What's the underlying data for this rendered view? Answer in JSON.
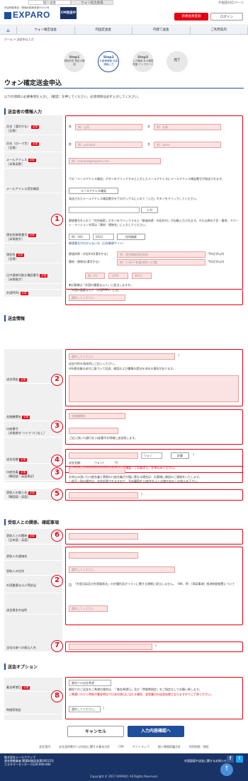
{
  "topbar": {
    "tabs": [
      "個人送金",
      "ウォン紀念金操"
    ],
    "lang": "外国語対応ページ"
  },
  "header": {
    "logo_sub": "資金移動業者・関東財務局長第00015号",
    "logo": "EXPARO",
    "cm": "CM放送中",
    "register": "新規会員登録",
    "login": "ログイン"
  },
  "nav": {
    "home": "⌂",
    "items": [
      "ウォン確定送金",
      "円固定送金",
      "円建て送金",
      "ご利用案内"
    ]
  },
  "breadcrumb": "ホーム > 送金申込入力",
  "steps": [
    {
      "t": "Step1",
      "s": "規約的意 規定の確認"
    },
    {
      "t": "Step2",
      "s": "お客様情報 送金情報入力"
    },
    {
      "t": "Step3",
      "s": "入力確認 本人確認書類 アップロード"
    },
    {
      "t": "完了",
      "s": ""
    }
  ],
  "page_title": "ウォン確定送金申込",
  "note": "以下の項目に必要事項を入力し［確認］を押してください。必須項目は必ず入力してください。",
  "req": "必須",
  "sec1": "送金者の情報入力",
  "kanji_label": "氏名（漢字かな）",
  "kanji_sub": "［全角］",
  "kanji_sei": "姓",
  "kanji_mei": "名",
  "kanji_ph1": "例）山田",
  "kanji_ph2": "例）太郎",
  "roman_label": "氏名（ローマ字）",
  "roman_sub": "［全角］",
  "roman_ph1": "例）yamada",
  "roman_ph2": "例）tarou",
  "email_label": "メールアドレス",
  "email_sub": "［半角英数］",
  "email_ph": "例）example@exparo.com",
  "email_conf_label": "メールアドレス受信確認",
  "email_conf_txt1": "下の「メールアドレス確認」ボタンをクリックすると入力したメールアドレスにメールアドレス確認番号が発送されます。",
  "email_conf_btn": "メールアドレス確認",
  "email_conf_txt2": "発送されたメールアドレス確認番号を下のボックスに入れて「入力」ボタンをクリックしてください。",
  "email_conf_enter": "入力",
  "zip_label": "現住所郵便番号",
  "zip_sub": "［半角数字］",
  "zip_txt": "郵便番号を入れて「住所検索」ボタンをクリックすると「都道府県・市区町村」が自動入力されます。それ以降の丁目・番地、アパート・マンション名等は「番地・建物名」に入力してください。",
  "zip1": "例）160",
  "zip2": "0022",
  "zip_btn": "住所検索",
  "zip_unknown": "郵便番号がわからない方（日本郵便サイト）",
  "addr_label": "現住所",
  "addr_sub": "［全角］",
  "addr_city_lbl": "都道府県・市区町村(漢字かな)",
  "addr_city_ph": "例）東京都新宿区新宿",
  "addr_street_lbl": "番地・建物名(漢字かな)",
  "addr_street_ph": "例）1-36-7 新宿内野ビル2階",
  "addr_limit": "*50文字以内",
  "phone_label": "日中連絡可能な電話番号",
  "phone_sub": "［半角数字］",
  "phone": [
    "例）03",
    "3359",
    "0023"
  ],
  "peps_label": "外国PEPs",
  "peps_txt1": "▼お客様は「外国の重要な公人」に該当しますか。",
  "peps_txt2": "『外国の重要な公人（外国PEPs）とは』",
  "select_ph": "選択してください",
  "sec2": "送金情報",
  "purpose_label": "送金理由",
  "purpose_txt1": "送金目的を具体的にご記入ください。",
  "purpose_txt2": "※所属金額の送付に基づいて記述。確認および書類の提出を求める場合があります。",
  "bank_label": "金融機関名",
  "bank_sel": "金融機関名",
  "acct_label": "口座番号",
  "acct_sub": "［半角数字 ハイフン(-)なし］",
  "acct_txt": "ご記入頂いた銀行名 口座番号を明確に送金致します。",
  "amount_label": "送金金額",
  "amount_cur": "ウォン",
  "amount_calc": "計算",
  "amount_row2a": "送金金額：",
  "amount_row2b": "ウォン/",
  "amount_row2c": "円",
  "amount_warn": "※ 送金サービスの内容にご留意ください。ご確認・ご同意の上、お申込みください。",
  "acct_name_label": "口座名義",
  "acct_name_sub": "［韓国語・英語表記］",
  "acct_name_txt1": "お申込み頂いた口座名義と実際の口座名義が大幅に異なる場合は、お客様に確認のご連絡をいたします。",
  "acct_name_txt2": "一部不一致の場合は、送金処理されますので、予め韓国名 口座名をよくお確かめの上お申込み下さい。",
  "recv_name_label": "受取人の個人名",
  "recv_name_sub": "［韓国語・英語］",
  "sec3": "受取人との関係、確認事項",
  "rel_label": "受取人との関係",
  "rel_sub": "［日本語・英語］",
  "recv_phone_label": "受取人の連絡先",
  "recv_addr_label": "受取人の住所",
  "recv_peps_label": "外国重要な公人等該当",
  "recv_peps_txt": "「外国当局及び外国貿易法」の在籍所及びイランに関する規制に該当しません。（NK、IR）［承認事項］経済制裁措置について",
  "recv_type_label": "送金資金の出所",
  "recv_person_label": "当社口座への振込人名",
  "sec4": "送金オプション",
  "opt_date_label": "着金希望日",
  "opt_date_sel": "最短での送金希望",
  "opt_date_txt1": "最短でのご送金をご希望の場合は、「着金希望日」及び「時間帯指定」をご指定なしでお願い致します。",
  "opt_date_txt2": "ご希望いただく時刻が着金時点で日本の休日に当たる場合、翌営業日の送金処理となりますのでご了承ください。",
  "opt_time_label": "時間帯指定",
  "opt_time_sel": "選択してください。",
  "cancel": "キャンセル",
  "confirm": "入力内容確認へ",
  "footer_links": [
    "会社案内",
    "反社会的勢力への対応に関する基本方針",
    "CPA",
    "サイトマップ",
    "個人情報保護方針",
    "利用約款・規定"
  ],
  "footer_co": [
    "株式会社シーエクアップ",
    "資金移動業者 関東財務局長第00015号",
    "カスタマーセンター 0120-000-000"
  ],
  "footer_follow": "外国語版や送金に関するお知らせ",
  "copyright": "Copyright © 2017 EXPARO. All Rights Reserved.",
  "markers": [
    "1",
    "2",
    "3",
    "4",
    "3",
    "5",
    "6",
    "2",
    "7",
    "8"
  ]
}
